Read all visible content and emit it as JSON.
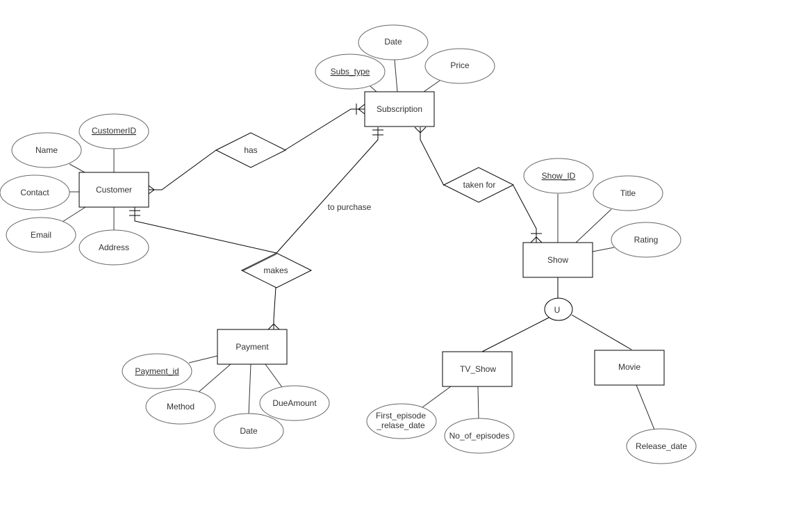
{
  "diagram": {
    "type": "er-diagram",
    "entities": {
      "customer": "Customer",
      "subscription": "Subscription",
      "payment": "Payment",
      "show": "Show",
      "tv_show": "TV_Show",
      "movie": "Movie"
    },
    "relationships": {
      "has": "has",
      "makes": "makes",
      "taken_for": "taken for"
    },
    "edge_labels": {
      "to_purchase": "to purchase"
    },
    "specialization_symbol": "U",
    "attributes": {
      "customer": {
        "customer_id": {
          "label": "CustomerID",
          "key": true
        },
        "name": {
          "label": "Name",
          "key": false
        },
        "contact": {
          "label": "Contact",
          "key": false
        },
        "email": {
          "label": "Email",
          "key": false
        },
        "address": {
          "label": "Address",
          "key": false
        }
      },
      "subscription": {
        "subs_type": {
          "label": "Subs_type",
          "key": true
        },
        "date": {
          "label": "Date",
          "key": false
        },
        "price": {
          "label": "Price",
          "key": false
        }
      },
      "payment": {
        "payment_id": {
          "label": "Payment_id",
          "key": true
        },
        "method": {
          "label": "Method",
          "key": false
        },
        "date": {
          "label": "Date",
          "key": false
        },
        "due_amount": {
          "label": "DueAmount",
          "key": false
        }
      },
      "show": {
        "show_id": {
          "label": "Show_ID",
          "key": true
        },
        "title": {
          "label": "Title",
          "key": false
        },
        "rating": {
          "label": "Rating",
          "key": false
        }
      },
      "tv_show": {
        "first_episode_line1": "First_episode",
        "first_episode_line2": "_relase_date",
        "no_of_episodes": {
          "label": "No_of_episodes",
          "key": false
        }
      },
      "movie": {
        "release_date": {
          "label": "Release_date",
          "key": false
        }
      }
    },
    "connections": [
      {
        "from": "Customer",
        "to": "has",
        "end_notation": "crow-foot"
      },
      {
        "from": "has",
        "to": "Subscription",
        "end_notation": "one-or-many"
      },
      {
        "from": "Customer",
        "to": "makes",
        "end_notation": "one-and-only-one"
      },
      {
        "from": "Subscription",
        "to": "makes",
        "end_notation": "one-and-only-one",
        "label": "to purchase"
      },
      {
        "from": "makes",
        "to": "Payment",
        "end_notation": "crow-foot"
      },
      {
        "from": "Subscription",
        "to": "taken for",
        "end_notation": "crow-foot"
      },
      {
        "from": "taken for",
        "to": "Show",
        "end_notation": "one-or-many"
      },
      {
        "from": "Show",
        "to": "U"
      },
      {
        "from": "U",
        "to": "TV_Show"
      },
      {
        "from": "U",
        "to": "Movie"
      }
    ]
  }
}
